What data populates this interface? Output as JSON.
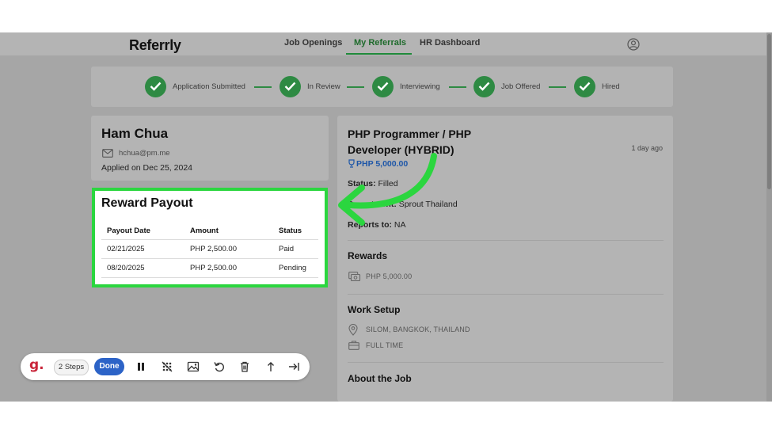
{
  "app": {
    "logo": "Referrly"
  },
  "nav": {
    "items": [
      {
        "label": "Job Openings",
        "active": false
      },
      {
        "label": "My Referrals",
        "active": true
      },
      {
        "label": "HR Dashboard",
        "active": false
      }
    ]
  },
  "stepper": {
    "steps": [
      {
        "label": "Application Submitted",
        "done": true
      },
      {
        "label": "In Review",
        "done": true
      },
      {
        "label": "Interviewing",
        "done": true
      },
      {
        "label": "Job Offered",
        "done": true
      },
      {
        "label": "Hired",
        "done": true
      }
    ]
  },
  "candidate": {
    "name": "Ham Chua",
    "email": "hchua@pm.me",
    "applied": "Applied on Dec 25, 2024"
  },
  "reward_payout": {
    "title": "Reward Payout",
    "columns": [
      "Payout Date",
      "Amount",
      "Status"
    ],
    "rows": [
      [
        "02/21/2025",
        "PHP 2,500.00",
        "Paid"
      ],
      [
        "08/20/2025",
        "PHP 2,500.00",
        "Pending"
      ]
    ]
  },
  "job": {
    "title": "PHP Programmer / PHP Developer (HYBRID)",
    "posted": "1 day ago",
    "bounty": "PHP 5,000.00",
    "status_label": "Status:",
    "status_value": "Filled",
    "department_label": "Department:",
    "department_value": "Sprout Thailand",
    "reports_label": "Reports to:",
    "reports_value": "NA",
    "rewards_title": "Rewards",
    "rewards_value": "PHP 5,000.00",
    "work_setup_title": "Work Setup",
    "location": "SILOM, BANGKOK, THAILAND",
    "employment_type": "FULL TIME",
    "about_title": "About the Job"
  },
  "toolbar": {
    "steps_label": "2 Steps",
    "done_label": "Done"
  },
  "colors": {
    "accent_green": "#2e8a43",
    "highlight_green": "#2bd63f",
    "link_blue": "#1d56a8",
    "done_blue": "#2c63c7"
  }
}
